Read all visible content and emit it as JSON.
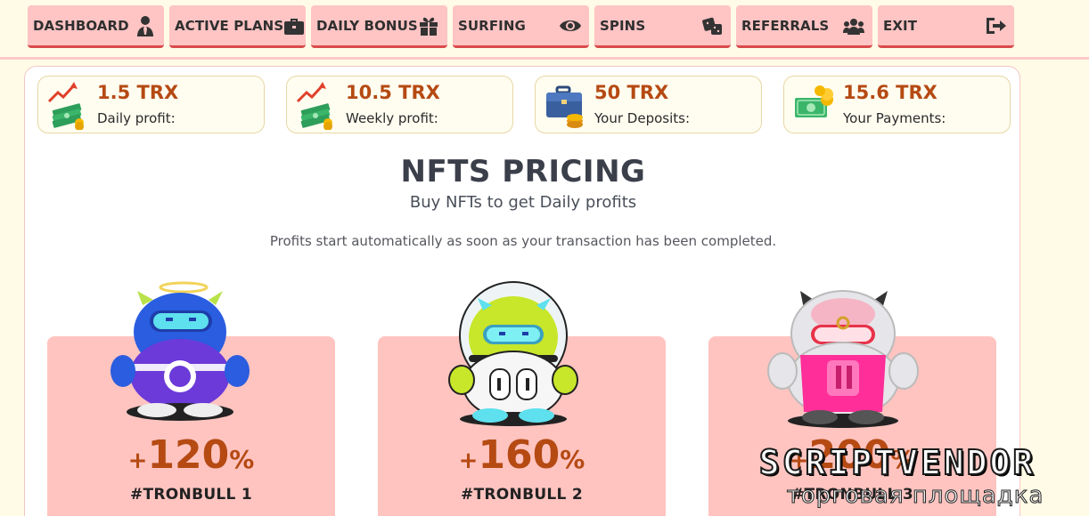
{
  "nav": {
    "items": [
      {
        "label": "DASHBOARD",
        "icon": "user-tie-icon"
      },
      {
        "label": "ACTIVE PLANS",
        "icon": "briefcase-icon"
      },
      {
        "label": "DAILY BONUS",
        "icon": "gift-icon"
      },
      {
        "label": "SURFING",
        "icon": "eye-icon"
      },
      {
        "label": "SPINS",
        "icon": "dice-icon"
      },
      {
        "label": "REFERRALS",
        "icon": "users-icon"
      },
      {
        "label": "EXIT",
        "icon": "sign-out-icon"
      }
    ]
  },
  "stats": [
    {
      "value": "1.5 TRX",
      "label": "Daily profit:",
      "icon": "money-growth-icon"
    },
    {
      "value": "10.5 TRX",
      "label": "Weekly profit:",
      "icon": "money-growth-icon"
    },
    {
      "value": "50 TRX",
      "label": "Your Deposits:",
      "icon": "briefcase-coins-icon"
    },
    {
      "value": "15.6 TRX",
      "label": "Your Payments:",
      "icon": "cash-coins-icon"
    }
  ],
  "page": {
    "title": "NFTS PRICING",
    "subtitle": "Buy NFTs to get Daily profits",
    "note": "Profits start automatically as soon as your transaction has been completed."
  },
  "nfts": [
    {
      "sign": "+",
      "percent": "120",
      "unit": "%",
      "name": "#TRONBULL 1",
      "color": "#3b3be0"
    },
    {
      "sign": "+",
      "percent": "160",
      "unit": "%",
      "name": "#TRONBULL 2",
      "color": "#c8e62a"
    },
    {
      "sign": "+",
      "percent": "200",
      "unit": "%",
      "name": "#TRONBULL 3",
      "color": "#e6e6ea"
    }
  ],
  "watermark": {
    "main": "SCRIPTVENDOR",
    "sub": "торговая площадка"
  },
  "colors": {
    "accent": "#b54a13",
    "nav_bg": "#ffc4c4",
    "card_bg": "#ffc4c0",
    "page_bg": "#fffbe6"
  }
}
